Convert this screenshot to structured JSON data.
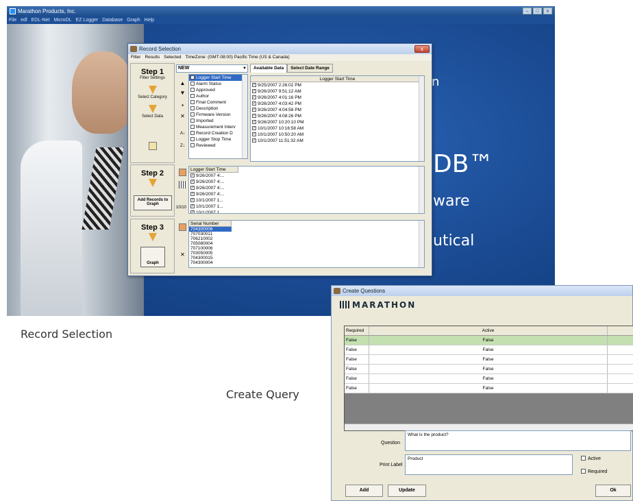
{
  "app": {
    "title": "Marathon Products, Inc.",
    "menu": [
      "File",
      "edl",
      "EDL-Net",
      "MicroDL",
      "EZ Logger",
      "Database",
      "Graph",
      "Help"
    ],
    "controls": [
      "‒",
      "□",
      "x"
    ],
    "brand_fragments": [
      "n",
      "DB™",
      "ware",
      "utical"
    ]
  },
  "record_selection": {
    "title": "Record Selection",
    "close": "x",
    "menu": [
      "Filter",
      "Results",
      "Selected",
      "TimeZone: (GMT-08:00) Pacific Time (US & Canada)"
    ],
    "step1": {
      "title": "Step 1",
      "filter_settings": "Filter Settings",
      "select_category": "Select Category",
      "select_data": "Select Data"
    },
    "filter_name": "NEW",
    "categories": [
      {
        "label": "Logger Start Time",
        "checked": true
      },
      {
        "label": "Alarm Status",
        "checked": false
      },
      {
        "label": "Approved",
        "checked": false
      },
      {
        "label": "Author",
        "checked": false
      },
      {
        "label": "Final Comment",
        "checked": false
      },
      {
        "label": "Description",
        "checked": false
      },
      {
        "label": "Firmware Version",
        "checked": false
      },
      {
        "label": "Imported",
        "checked": false
      },
      {
        "label": "Measurement Interv",
        "checked": false
      },
      {
        "label": "Record Creation D",
        "checked": false
      },
      {
        "label": "Logger Stop Time",
        "checked": false
      },
      {
        "label": "Reviewed",
        "checked": false
      }
    ],
    "tabs": [
      "Available Data",
      "Select Date Range"
    ],
    "available_header": "Logger Start Time",
    "available_data": [
      "9/25/2007 2:26:02 PM",
      "9/26/2007 9:51:12 AM",
      "9/26/2007 4:01:16 PM",
      "9/26/2007 4:03:42 PM",
      "9/26/2007 4:04:58 PM",
      "9/26/2007 4:08:26 PM",
      "9/26/2007 10:20:10 PM",
      "10/1/2007 10:16:58 AM",
      "10/1/2007 10:50:20 AM",
      "10/1/2007 11:51:32 AM"
    ],
    "step2": {
      "title": "Step 2",
      "add_records": "Add Records to Graph",
      "count": "10/10"
    },
    "step2_header": "Logger Start Time",
    "step2_rows": [
      "9/26/2007 4:...",
      "9/26/2007 4:...",
      "9/26/2007 4:...",
      "9/26/2007 4:...",
      "10/1/2007 1...",
      "10/1/2007 1...",
      "10/1/2007 1..."
    ],
    "step3": {
      "title": "Step 3",
      "graph": "Graph"
    },
    "serial_header": "Serial Number",
    "serials": [
      "704300006",
      "707030011",
      "706210002",
      "705080004",
      "707100006",
      "703050005",
      "704300015",
      "704300004"
    ]
  },
  "create_questions": {
    "title": "Create Questions",
    "logo": "MARATHON",
    "columns": [
      "Required",
      "Active"
    ],
    "rows": [
      {
        "required": "False",
        "active": "False"
      },
      {
        "required": "False",
        "active": "False"
      },
      {
        "required": "False",
        "active": "False"
      },
      {
        "required": "False",
        "active": "False"
      },
      {
        "required": "False",
        "active": "False"
      },
      {
        "required": "False",
        "active": "False"
      }
    ],
    "question_label": "Question",
    "question_value": "What is the product?",
    "print_label": "Print Label",
    "print_value": "Product",
    "active_label": "Active",
    "required_label": "Required",
    "add": "Add",
    "update": "Update",
    "ok": "Ok"
  },
  "captions": {
    "record_selection": "Record Selection",
    "create_query": "Create Query"
  }
}
